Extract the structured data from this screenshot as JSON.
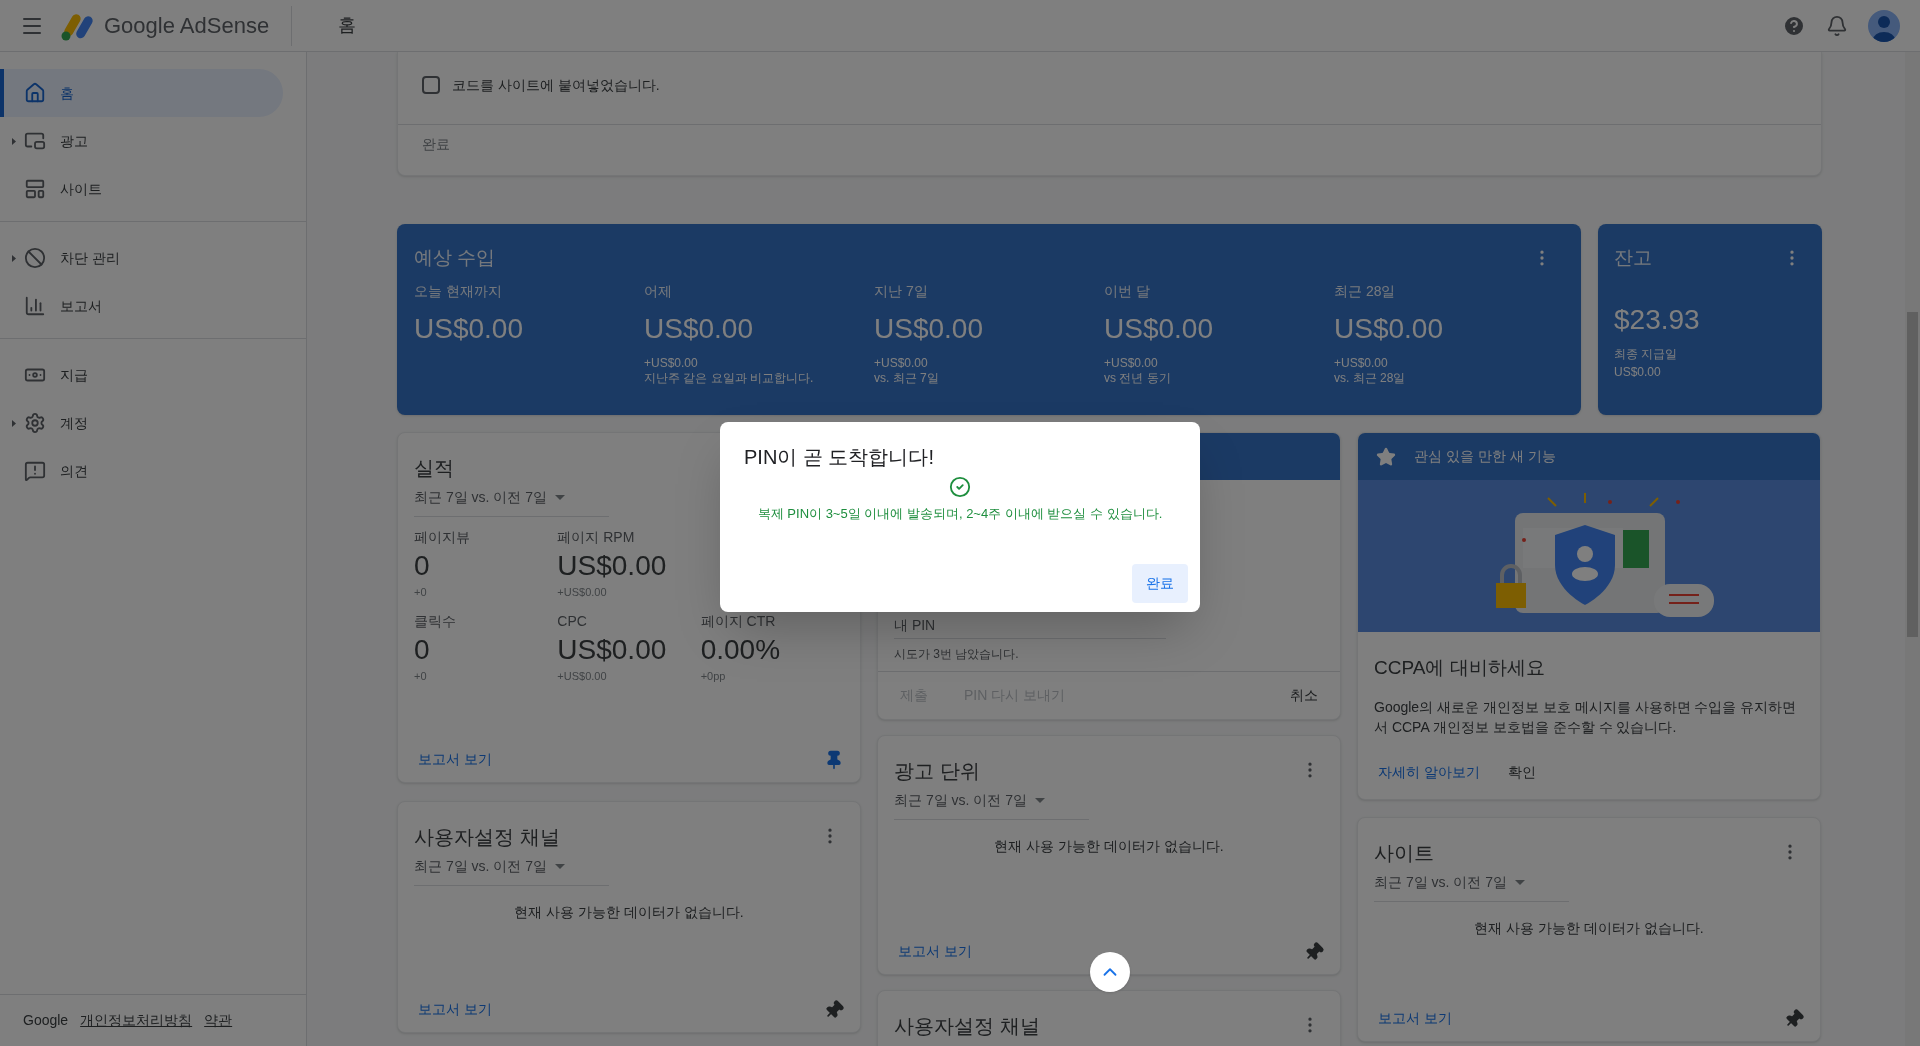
{
  "header": {
    "app_title": "Google AdSense",
    "page_title": "홈"
  },
  "sidebar": {
    "groups": [
      [
        {
          "label": "홈",
          "selected": true,
          "expandable": false
        },
        {
          "label": "광고",
          "selected": false,
          "expandable": true
        },
        {
          "label": "사이트",
          "selected": false,
          "expandable": false
        }
      ],
      [
        {
          "label": "차단 관리",
          "selected": false,
          "expandable": true
        },
        {
          "label": "보고서",
          "selected": false,
          "expandable": false
        }
      ],
      [
        {
          "label": "지급",
          "selected": false,
          "expandable": false
        },
        {
          "label": "계정",
          "selected": false,
          "expandable": true
        },
        {
          "label": "의견",
          "selected": false,
          "expandable": false
        }
      ]
    ],
    "footer": {
      "brand": "Google",
      "links": [
        "개인정보처리방침",
        "약관"
      ]
    }
  },
  "setup_card": {
    "checkbox": {
      "label": "코드를 사이트에 붙여넣었습니다.",
      "checked": false
    },
    "action": {
      "label": "완료",
      "disabled": true
    }
  },
  "earnings": {
    "title": "예상 수입",
    "columns": [
      {
        "label": "오늘 현재까지",
        "value": "US$0.00"
      },
      {
        "label": "어제",
        "value": "US$0.00",
        "delta": "+US$0.00",
        "note": "지난주 같은 요일과 비교합니다."
      },
      {
        "label": "지난 7일",
        "value": "US$0.00",
        "delta": "+US$0.00",
        "note": "vs. 최근 7일"
      },
      {
        "label": "이번 달",
        "value": "US$0.00",
        "delta": "+US$0.00",
        "note": "vs 전년 동기"
      },
      {
        "label": "최근 28일",
        "value": "US$0.00",
        "delta": "+US$0.00",
        "note": "vs. 최근 28일"
      }
    ]
  },
  "balance": {
    "title": "잔고",
    "amount": "$23.93",
    "label": "최종 지급일",
    "value": "US$0.00"
  },
  "performance": {
    "title": "실적",
    "range": "최근 7일 vs. 이전 7일",
    "metric_rows": [
      [
        {
          "label": "페이지뷰",
          "value": "0",
          "delta": "+0"
        },
        {
          "label": "페이지 RPM",
          "value": "US$0.00",
          "delta": "+US$0.00"
        }
      ],
      [
        {
          "label": "클릭수",
          "value": "0",
          "delta": "+0"
        },
        {
          "label": "CPC",
          "value": "US$0.00",
          "delta": "+US$0.00"
        },
        {
          "label": "페이지 CTR",
          "value": "0.00%",
          "delta": "+0pp"
        }
      ]
    ],
    "link": "보고서 보기",
    "pinned": true
  },
  "custom_channels": {
    "title": "사용자설정 채널",
    "range": "최근 7일 vs. 이전 7일",
    "empty": "현재 사용 가능한 데이터가 없습니다.",
    "link": "보고서 보기",
    "pinned": false
  },
  "pin_card": {
    "field_label": "내 PIN",
    "attempts": "시도가 3번 남았습니다.",
    "actions": [
      {
        "label": "제출",
        "disabled": true
      },
      {
        "label": "PIN 다시 보내기",
        "disabled": true
      },
      {
        "label": "취소",
        "disabled": false
      }
    ]
  },
  "ad_units": {
    "title": "광고 단위",
    "range": "최근 7일 vs. 이전 7일",
    "empty": "현재 사용 가능한 데이터가 없습니다.",
    "link": "보고서 보기",
    "pinned": false
  },
  "custom_channels_2": {
    "title": "사용자설정 채널"
  },
  "features": {
    "header": "관심 있을 만한 새 기능",
    "title": "CCPA에 대비하세요",
    "body": "Google의 새로운 개인정보 보호 메시지를 사용하면 수입을 유지하면서 CCPA 개인정보 보호법을 준수할 수 있습니다.",
    "actions": [
      {
        "label": "자세히 알아보기",
        "kind": "link"
      },
      {
        "label": "확인",
        "kind": "plain"
      }
    ]
  },
  "sites": {
    "title": "사이트",
    "range": "최근 7일 vs. 이전 7일",
    "empty": "현재 사용 가능한 데이터가 없습니다.",
    "link": "보고서 보기",
    "pinned": false
  },
  "dialog": {
    "title": "PIN이 곧 도착합니다!",
    "message": "복제 PIN이 3~5일 이내에 발송되며, 2~4주 이내에 받으실 수 있습니다.",
    "button": "완료"
  }
}
